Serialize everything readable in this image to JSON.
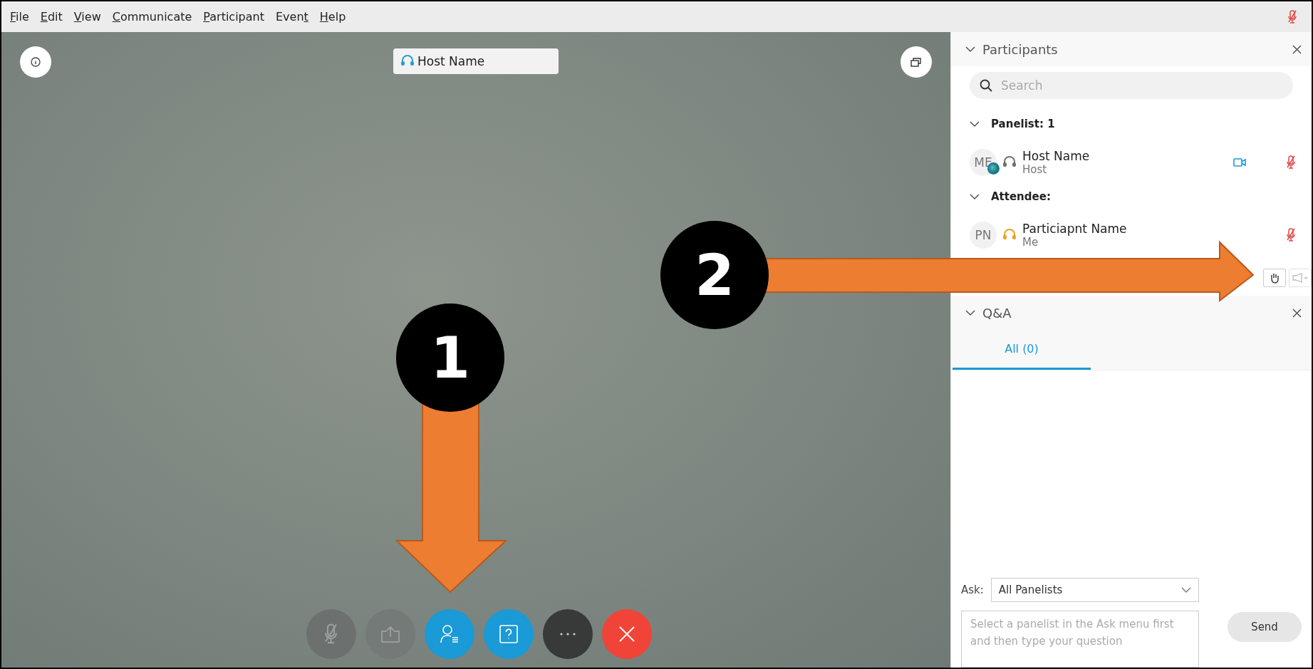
{
  "menu": [
    {
      "parts": [
        {
          "text": "F",
          "underlined": true
        },
        {
          "text": "ile",
          "underlined": false
        }
      ]
    },
    {
      "parts": [
        {
          "text": "E",
          "underlined": true
        },
        {
          "text": "dit",
          "underlined": false
        }
      ]
    },
    {
      "parts": [
        {
          "text": "V",
          "underlined": true
        },
        {
          "text": "iew",
          "underlined": false
        }
      ]
    },
    {
      "parts": [
        {
          "text": "C",
          "underlined": true
        },
        {
          "text": "ommunicate",
          "underlined": false
        }
      ]
    },
    {
      "parts": [
        {
          "text": "P",
          "underlined": true
        },
        {
          "text": "articipant",
          "underlined": false
        }
      ]
    },
    {
      "parts": [
        {
          "text": "Even",
          "underlined": false
        },
        {
          "text": "t",
          "underlined": true
        }
      ]
    },
    {
      "parts": [
        {
          "text": "H",
          "underlined": true
        },
        {
          "text": "elp",
          "underlined": false
        }
      ]
    }
  ],
  "title_mic_muted": true,
  "video": {
    "host_tag": "Host Name",
    "toolbar": [
      {
        "kind": "mute"
      },
      {
        "kind": "share"
      },
      {
        "kind": "participants"
      },
      {
        "kind": "qa"
      },
      {
        "kind": "more"
      },
      {
        "kind": "leave"
      }
    ]
  },
  "participants": {
    "title": "Participants",
    "expanded": true,
    "search": {
      "placeholder": "Search"
    },
    "groups": [
      {
        "label": "Panelist: 1",
        "expanded": true,
        "members": [
          {
            "initials": "ME",
            "name": "Host Name",
            "role": "Host",
            "presence": true,
            "color": "#707070",
            "video": true,
            "muted": true
          }
        ]
      },
      {
        "label": "Attendee:",
        "expanded": true,
        "members": [
          {
            "initials": "PN",
            "name": "Particiapnt Name",
            "role": "Me",
            "presence": false,
            "color": "#f0a020",
            "video": false,
            "muted": true
          }
        ]
      }
    ]
  },
  "qa": {
    "title": "Q&A",
    "expanded": true,
    "tabs": [
      {
        "label": "All (0)",
        "selected": true
      }
    ],
    "ask_label": "Ask:",
    "ask_value": "All Panelists",
    "question": {
      "placeholder": "Select a panelist in the Ask menu first and then type your question"
    },
    "send": "Send"
  },
  "annotations": [
    {
      "number": "1",
      "kind": "down"
    },
    {
      "number": "2",
      "kind": "right"
    }
  ]
}
